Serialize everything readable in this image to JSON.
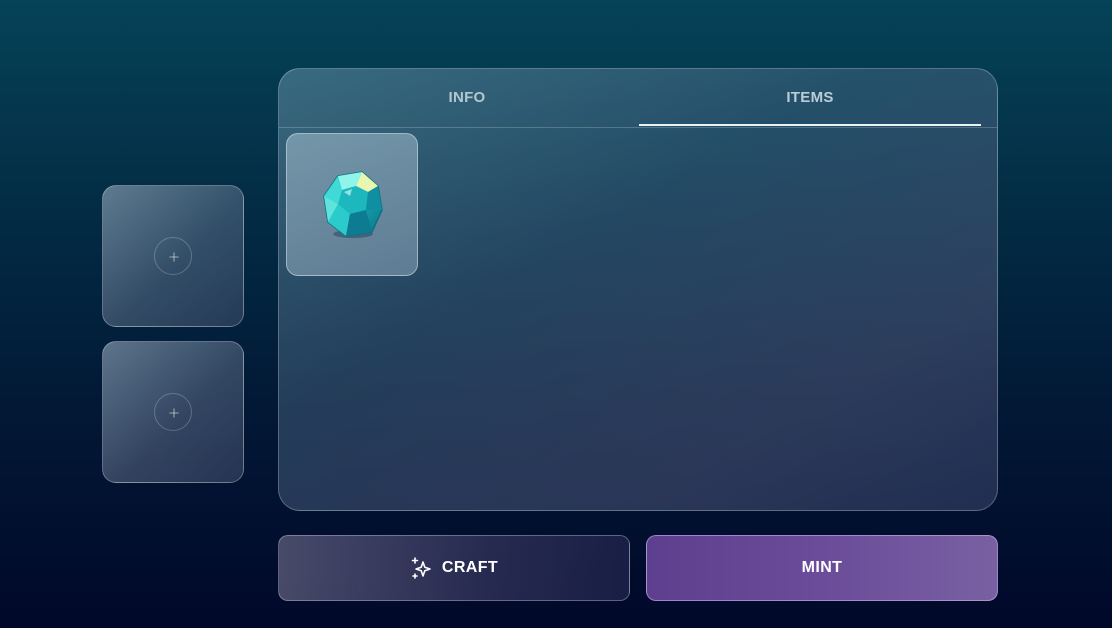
{
  "slots": [
    {
      "icon": "plus-icon"
    },
    {
      "icon": "plus-icon"
    }
  ],
  "panel": {
    "tabs": [
      {
        "label": "INFO",
        "active": false
      },
      {
        "label": "ITEMS",
        "active": true
      }
    ],
    "items": [
      {
        "icon": "teal-gem-icon"
      }
    ]
  },
  "actions": {
    "craft_label": "CRAFT",
    "craft_icon": "sparkles-icon",
    "mint_label": "MINT"
  },
  "colors": {
    "mint_accent": "#6a4c9a",
    "gem": "#19c2c4"
  }
}
